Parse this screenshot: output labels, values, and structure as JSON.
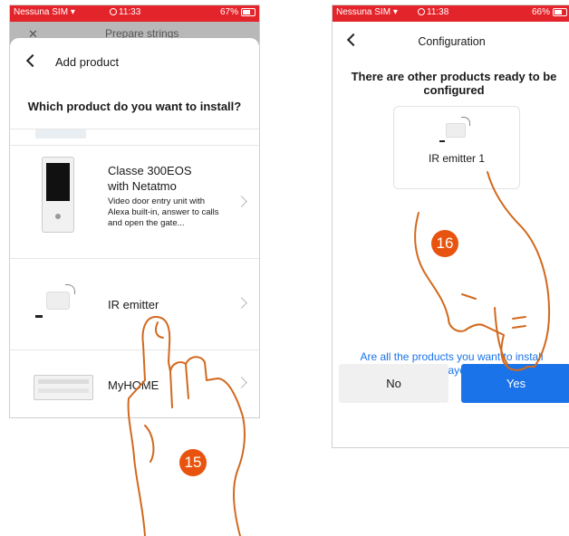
{
  "left_phone": {
    "status": {
      "carrier": "Nessuna SIM",
      "time": "11:33",
      "battery": "67%"
    },
    "bg_header": {
      "title": "Prepare strings"
    },
    "sheet": {
      "title": "Add product",
      "question": "Which product do you want to install?",
      "products": [
        {
          "name": "Classe 300EOS with Netatmo",
          "description": "Video door entry unit with Alexa built-in, answer to calls and open the gate..."
        },
        {
          "name": "IR emitter"
        },
        {
          "name": "MyHOME"
        }
      ]
    },
    "step": "15"
  },
  "right_phone": {
    "status": {
      "carrier": "Nessuna SIM",
      "time": "11:38",
      "battery": "66%"
    },
    "header": {
      "title": "Configuration"
    },
    "message": "There are other products ready to be configured",
    "card": {
      "label": "IR emitter 1"
    },
    "question": "Are all the products you want to install displayed?",
    "buttons": {
      "no": "No",
      "yes": "Yes"
    },
    "step": "16"
  },
  "colors": {
    "status": "#e3242b",
    "accent": "#1a73e8",
    "step": "#e8540f",
    "hand": "#d2691e",
    "link": "#1a73e8"
  }
}
